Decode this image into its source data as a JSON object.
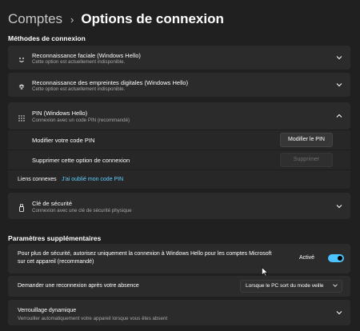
{
  "header": {
    "breadcrumb_parent": "Comptes",
    "separator": "›",
    "title": "Options de connexion"
  },
  "sections": {
    "methods": "Méthodes de connexion",
    "additional": "Paramètres supplémentaires"
  },
  "methods": {
    "face": {
      "title": "Reconnaissance faciale (Windows Hello)",
      "subtitle": "Cette option est actuellement indisponible."
    },
    "fingerprint": {
      "title": "Reconnaissance des empreintes digitales (Windows Hello)",
      "subtitle": "Cette option est actuellement indisponible."
    },
    "pin": {
      "title": "PIN (Windows Hello)",
      "subtitle": "Connexion avec un code PIN (recommandé)",
      "change_label": "Modifier votre code PIN",
      "change_button": "Modifier le PIN",
      "remove_label": "Supprimer cette option de connexion",
      "remove_button": "Supprimer",
      "related_label": "Liens connexes",
      "forgot_link": "J'ai oublié mon code PIN"
    },
    "security_key": {
      "title": "Clé de sécurité",
      "subtitle": "Connexion avec une clé de sécurité physique"
    }
  },
  "additional": {
    "hello_only": {
      "text_line1": "Pour plus de sécurité, autorisez uniquement la connexion à Windows Hello pour les comptes Microsoft",
      "text_line2": "sur cet appareil (recommandé)",
      "state_label": "Activé",
      "enabled": true
    },
    "reconnect": {
      "label": "Demander une reconnexion après votre absence",
      "selected": "Lorsque le PC sort du mode veille"
    },
    "dynamic_lock": {
      "title": "Verrouillage dynamique",
      "subtitle": "Verrouiller automatiquement votre appareil lorsque vous êtes absent"
    }
  },
  "colors": {
    "background": "#202020",
    "card": "#2b2b2b",
    "accent": "#4cc2ff",
    "link": "#60cdff"
  },
  "icons": [
    "smiley-icon",
    "fingerprint-icon",
    "keypad-icon",
    "usb-key-icon",
    "chevron-down-icon",
    "chevron-up-icon",
    "chevron-right-icon"
  ]
}
